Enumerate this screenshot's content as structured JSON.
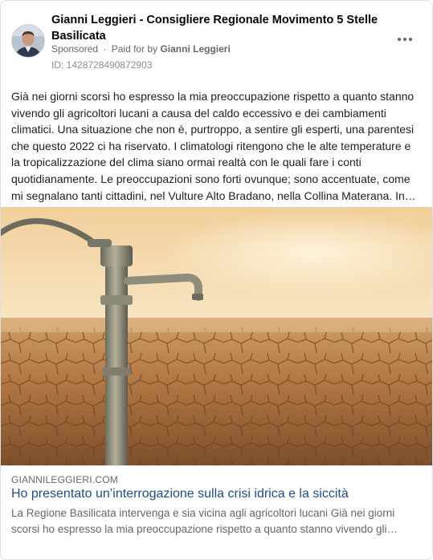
{
  "post": {
    "author": "Gianni Leggieri - Consigliere Regionale Movimento 5 Stelle Basilicata",
    "sponsored_label": "Sponsored",
    "paid_for_prefix": "Paid for by",
    "paid_for_name": "Gianni Leggieri",
    "ad_id": "ID: 1428728490872903",
    "more_icon": "more-horizontal-icon",
    "text": "Già nei giorni scorsi ho espresso la mia preoccupazione rispetto a quanto stanno vivendo gli agricoltori lucani a causa del caldo eccessivo e dei cambiamenti climatici. Una situazione che non è, purtroppo, a sentire gli esperti, una parentesi che questo 2022 ci ha riservato. I climatologi ritengono che le alte temperature e la tropicalizzazione del clima siano ormai realtà con le quali fare i conti quotidianamente. Le preoccupazioni sono forti ovunque; sono accentuate, come mi segnalano tanti cittadini, nel Vulture Alto Bradano, nella Collina Materana. In…"
  },
  "link": {
    "domain": "GIANNILEGGIERI.COM",
    "title": "Ho presentato un’interrogazione sulla crisi idrica e la siccità",
    "description": "La Regione Basilicata intervenga e sia vicina agli agricoltori lucani Già nei giorni scorsi ho espresso la mia preoccupazione rispetto a quanto stanno vivendo gli…"
  },
  "colors": {
    "link_title": "#1d4e89",
    "secondary_text": "#65676b"
  }
}
